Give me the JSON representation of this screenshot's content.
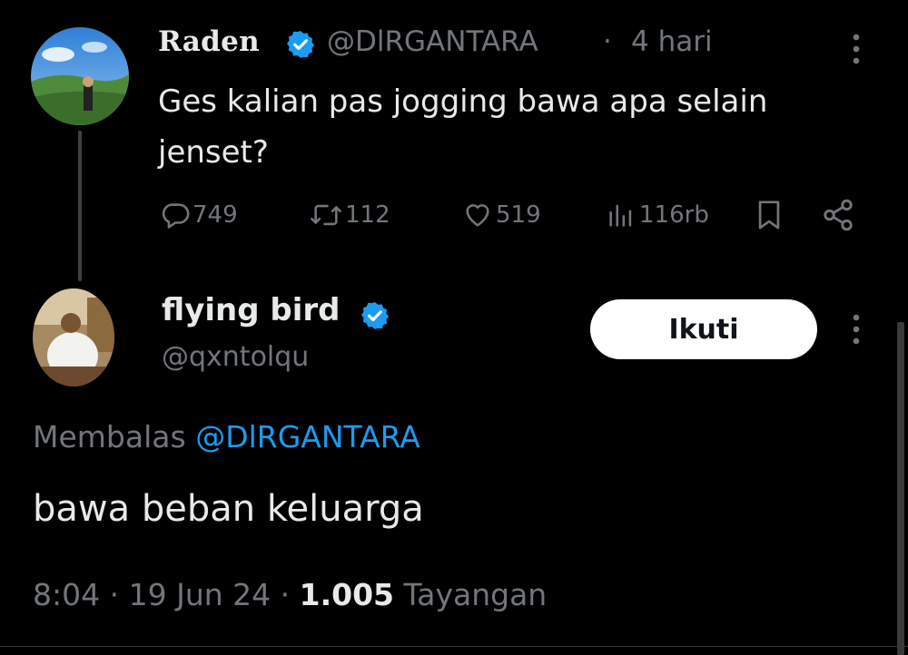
{
  "parent_tweet": {
    "author_name": "Raden",
    "handle": "@DlRGANTARA",
    "separator": "·",
    "time": "4 hari",
    "text": "Ges kalian pas jogging bawa apa selain jenset?",
    "stats": {
      "replies": "749",
      "reposts": "112",
      "likes": "519",
      "views": "116rb"
    }
  },
  "reply_tweet": {
    "author_name": "flying bird",
    "handle": "@qxntolqu",
    "follow_label": "Ikuti",
    "replying_to_label": "Membalas",
    "replying_to_handle": "@DlRGANTARA",
    "text": "bawa beban keluarga",
    "time": "8:04",
    "date": "19 Jun 24",
    "views_count": "1.005",
    "views_label": "Tayangan"
  },
  "icons": {
    "verified": "verified-badge-icon",
    "reply": "reply-icon",
    "repost": "repost-icon",
    "like": "heart-icon",
    "views": "views-icon",
    "bookmark": "bookmark-icon",
    "share": "share-icon",
    "more": "more-vertical-icon"
  },
  "colors": {
    "background": "#000000",
    "text_primary": "#e7e9ea",
    "text_secondary": "#71767b",
    "accent": "#1d9bf0",
    "follow_button_bg": "#ffffff"
  }
}
